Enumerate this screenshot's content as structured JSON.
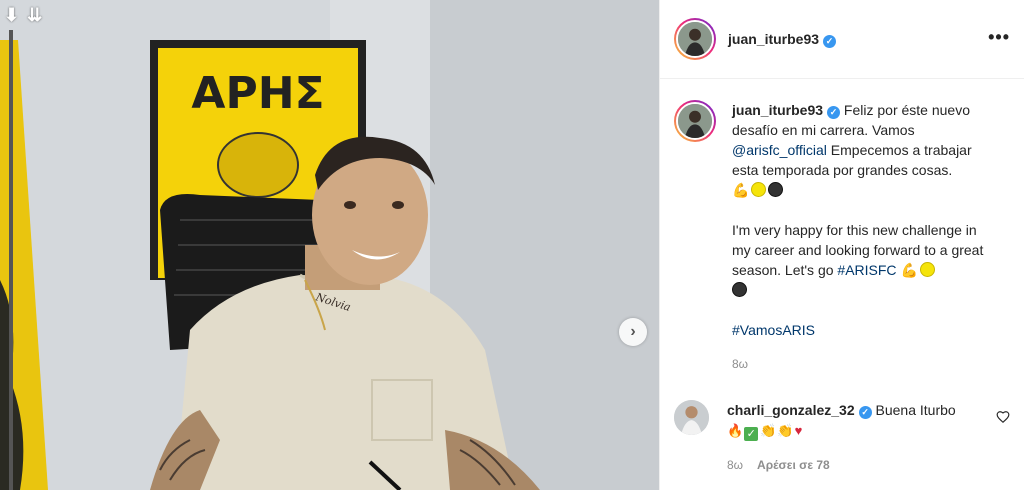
{
  "photo": {
    "sign_text": "ΑΡΗΣ",
    "tattoo_text": "Nolvia"
  },
  "post": {
    "username": "juan_iturbe93",
    "more_label": "•••",
    "verified_mark": "✓"
  },
  "caption": {
    "username": "juan_iturbe93",
    "line1": "Feliz por éste nuevo desafío en mi carrera. Vamos",
    "mention": "@arisfc_official",
    "line1b": "Empecemos a trabajar esta temporada por grandes cosas.",
    "english": "I'm very happy for this new challenge in my career and looking forward to a great season. Let's go",
    "hashtag1": "#ARISFC",
    "hashtag2": "#VamosARIS",
    "time": "8ω"
  },
  "comment": {
    "username": "charli_gonzalez_32",
    "text": "Buena Iturbo",
    "time": "8ω",
    "likes": "Αρέσει σε 78"
  },
  "icons": {
    "corner": [
      "download-arrow-icon",
      "double-down-arrow-icon"
    ],
    "next": "chevron-right-icon",
    "like": "heart-outline-icon"
  },
  "colors": {
    "link": "#00376b",
    "verified": "#3897f0",
    "meta": "#8e8e8e",
    "aris_yellow": "#f4d20a"
  }
}
